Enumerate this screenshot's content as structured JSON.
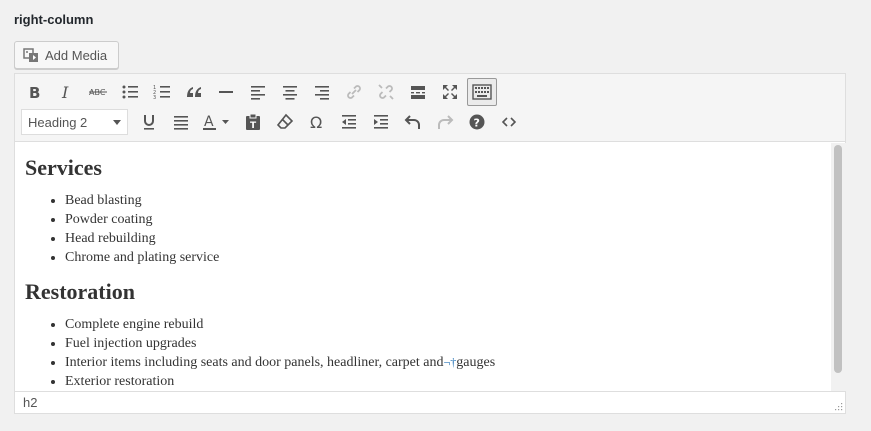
{
  "field_label": "right-column",
  "add_media": {
    "label": "Add Media",
    "icon": "add-media-icon"
  },
  "toolbar": {
    "row1": [
      {
        "name": "bold-icon"
      },
      {
        "name": "italic-icon"
      },
      {
        "name": "strikethrough-icon"
      },
      {
        "name": "bullet-list-icon"
      },
      {
        "name": "numbered-list-icon"
      },
      {
        "name": "blockquote-icon"
      },
      {
        "name": "horizontal-line-icon"
      },
      {
        "name": "align-left-icon"
      },
      {
        "name": "align-center-icon"
      },
      {
        "name": "align-right-icon"
      },
      {
        "name": "link-icon"
      },
      {
        "name": "unlink-icon"
      },
      {
        "name": "read-more-icon"
      },
      {
        "name": "fullscreen-icon"
      },
      {
        "name": "toolbar-toggle-icon"
      }
    ],
    "format_select": {
      "value": "Heading 2"
    },
    "row2": [
      {
        "name": "underline-icon"
      },
      {
        "name": "justify-icon"
      },
      {
        "name": "text-color-icon"
      },
      {
        "name": "paste-text-icon"
      },
      {
        "name": "clear-formatting-icon"
      },
      {
        "name": "special-character-icon"
      },
      {
        "name": "outdent-icon"
      },
      {
        "name": "indent-icon"
      },
      {
        "name": "undo-icon"
      },
      {
        "name": "redo-icon"
      },
      {
        "name": "help-icon"
      },
      {
        "name": "code-icon"
      }
    ]
  },
  "content": {
    "section1": {
      "heading": "Services",
      "items": [
        "Bead blasting",
        "Powder coating",
        "Head rebuilding",
        "Chrome and plating service"
      ]
    },
    "section2": {
      "heading": "Restoration",
      "items": [
        "Complete engine rebuild",
        "Fuel injection upgrades",
        "Interior items including seats and door panels, headliner, carpet and",
        "Exterior restoration"
      ],
      "nbsp_mark": "¬†",
      "after_mark": "gauges"
    }
  },
  "status_path": "h2"
}
